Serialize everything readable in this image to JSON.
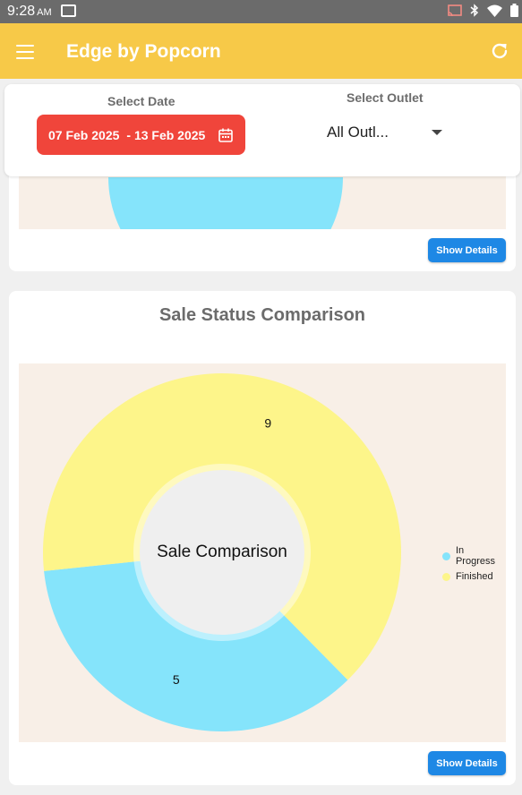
{
  "status_bar": {
    "time": "9:28",
    "ampm": "AM"
  },
  "app_bar": {
    "title": "Edge by Popcorn"
  },
  "filters": {
    "date_label": "Select Date",
    "date_start": "07 Feb 2025",
    "date_end": "- 13 Feb 2025",
    "outlet_label": "Select Outlet",
    "outlet_value": "All Outl..."
  },
  "top_card": {
    "details_label": "Show Details"
  },
  "sale_status_card": {
    "title": "Sale Status Comparison",
    "details_label": "Show Details"
  },
  "chart_data": {
    "type": "pie",
    "title": "Sale Status Comparison",
    "center_label": "Sale Comparison",
    "series": [
      {
        "name": "In Progress",
        "value": 5,
        "color": "#85e4fb"
      },
      {
        "name": "Finished",
        "value": 9,
        "color": "#fdf58a"
      }
    ],
    "legend_position": "right"
  },
  "colors": {
    "app_bar": "#f7c948",
    "date_button": "#f0453b",
    "details_button": "#1e88e5",
    "plot_background": "#f8efe7"
  }
}
